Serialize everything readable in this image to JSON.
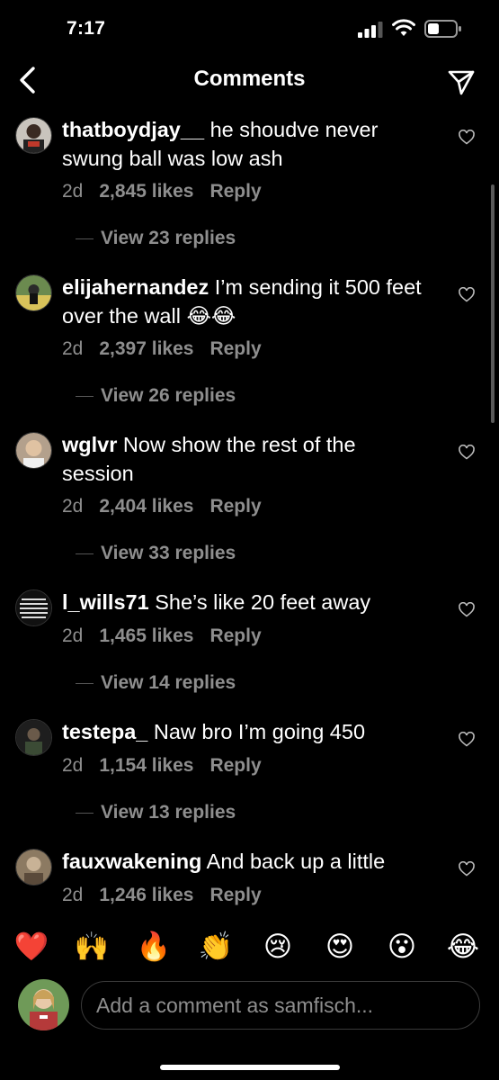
{
  "status_bar": {
    "time": "7:17"
  },
  "header": {
    "title": "Comments"
  },
  "comments": [
    {
      "username": "thatboydjay__",
      "text": "he shoudve never swung ball was low ash",
      "age": "2d",
      "likes": "2,845 likes",
      "reply": "Reply",
      "view_replies": "View 23 replies"
    },
    {
      "username": "elijahernandez",
      "text": "I’m sending it 500 feet over the wall 😂😂",
      "age": "2d",
      "likes": "2,397 likes",
      "reply": "Reply",
      "view_replies": "View 26 replies"
    },
    {
      "username": "wglvr",
      "text": "Now show the rest of the session",
      "age": "2d",
      "likes": "2,404 likes",
      "reply": "Reply",
      "view_replies": "View 33 replies"
    },
    {
      "username": "l_wills71",
      "text": "She’s like 20 feet away",
      "age": "2d",
      "likes": "1,465 likes",
      "reply": "Reply",
      "view_replies": "View 14 replies"
    },
    {
      "username": "testepa_",
      "text": "Naw bro I’m going 450",
      "age": "2d",
      "likes": "1,154 likes",
      "reply": "Reply",
      "view_replies": "View 13 replies"
    },
    {
      "username": "fauxwakening",
      "text": "And back up a little",
      "age": "2d",
      "likes": "1,246 likes",
      "reply": "Reply"
    }
  ],
  "emoji_bar": [
    "❤️",
    "🙌",
    "🔥",
    "👏",
    "😢",
    "😍",
    "😮",
    "😂"
  ],
  "comment_input": {
    "placeholder": "Add a comment as samfisch..."
  }
}
